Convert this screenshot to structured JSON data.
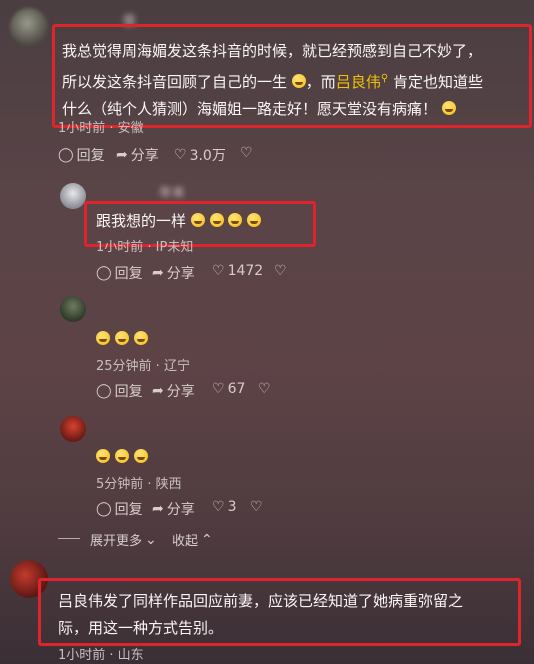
{
  "comments": [
    {
      "user": "　　　　　俊",
      "text_parts": [
        "我总觉得周海媚发这条抖音的时候，就已经预感到自己不妙了，",
        "所以发这条抖音回顾了自己的一生",
        "，而",
        "吕良伟",
        "肯定也知道些",
        "什么（纯个人猜测）海媚姐一路走好！愿天堂没有病痛！"
      ],
      "meta": "1小时前 · 安徽",
      "reply": "回复",
      "share": "分享",
      "likes": "3.0万"
    }
  ],
  "replies": [
    {
      "user": "　　　　　年本",
      "text": "跟我想的一样",
      "meta": "1小时前 · IP未知",
      "reply": "回复",
      "share": "分享",
      "likes": "1472"
    },
    {
      "user": "　　　　　　",
      "meta": "25分钟前 · 辽宁",
      "reply": "回复",
      "share": "分享",
      "likes": "67"
    },
    {
      "user": "　　　　　　　　　",
      "meta": "5分钟前 · 陕西",
      "reply": "回复",
      "share": "分享",
      "likes": "3"
    }
  ],
  "thread_controls": {
    "expand": "展开更多",
    "collapse": "收起"
  },
  "bottom_comment": {
    "line1": "吕良伟发了同样作品回应前妻，应该已经知道了她病重弥留之",
    "line2": "际，用这一种方式告别。",
    "meta": "1小时前 · 山东"
  },
  "colors": {
    "highlight": "#e0242b",
    "link": "#f2c400"
  },
  "icons": [
    "comment-icon",
    "share-icon",
    "heart-icon",
    "dislike-icon",
    "search-icon",
    "emoji-cry"
  ]
}
